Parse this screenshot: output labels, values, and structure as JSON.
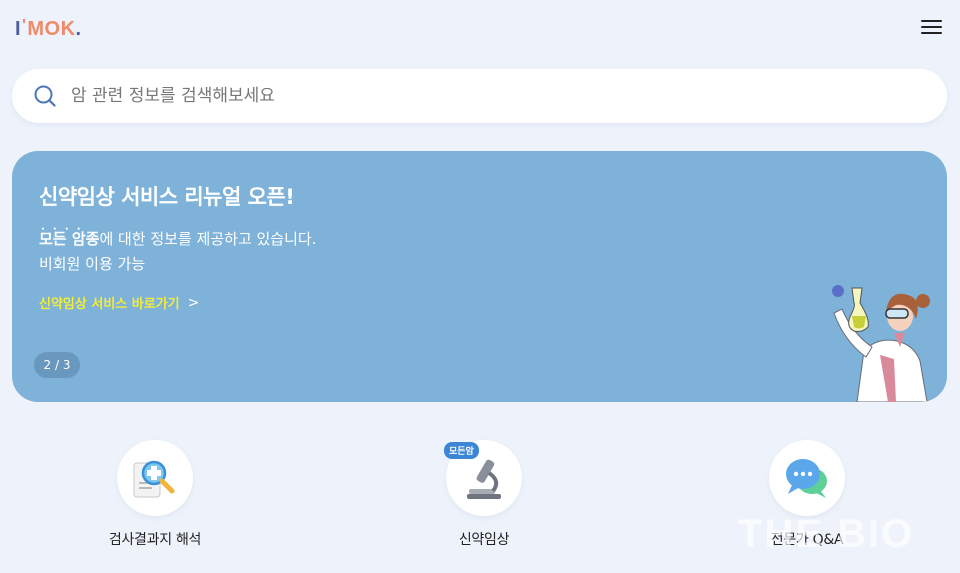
{
  "header": {
    "logo": {
      "i": "I",
      "apos": "'",
      "mok": "MOK",
      "dot": "."
    },
    "menu_icon": "hamburger-menu-icon"
  },
  "search": {
    "placeholder": "암 관련 정보를 검색해보세요",
    "icon": "search-icon"
  },
  "banner": {
    "title": "신약임상 서비스 리뉴얼 오픈!",
    "desc_em": "모든 암종",
    "desc_rest": "에 대한 정보를 제공하고 있습니다.",
    "desc_line2": "비회원 이용 가능",
    "link_label": "신약임상 서비스 바로가기",
    "link_chevron": ">",
    "pager": "2 / 3",
    "bg_color": "#7eb2d9",
    "link_color": "#f2ec3a"
  },
  "shortcuts": [
    {
      "label": "검사결과지 해석",
      "icon": "report-magnifier-icon"
    },
    {
      "label": "신약임상",
      "icon": "microscope-icon",
      "badge": "모든암"
    },
    {
      "label": "전문가 Q&A",
      "icon": "chat-bubbles-icon"
    }
  ],
  "watermark": "THE BIO"
}
